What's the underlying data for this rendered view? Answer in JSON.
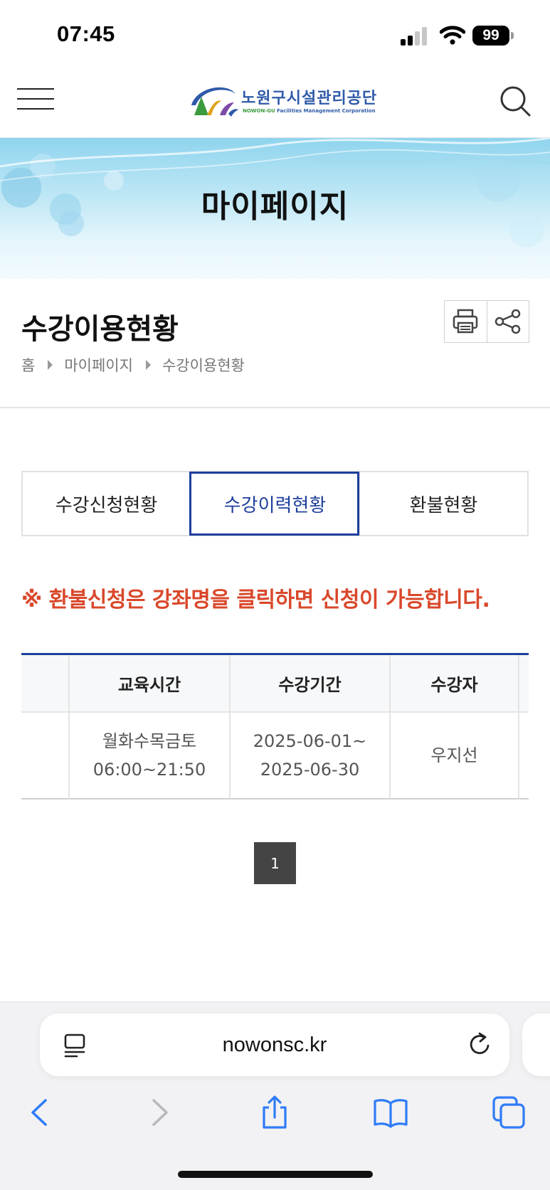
{
  "status_bar": {
    "time": "07:45",
    "battery": "99"
  },
  "header": {
    "logo_kr": "노원구시설관리공단",
    "logo_en_1": "NOWON-GU",
    "logo_en_2": "Facilities",
    "logo_en_3": "Management Corporation",
    "menu_icon": "hamburger-icon",
    "search_icon": "search-icon"
  },
  "banner": {
    "title": "마이페이지"
  },
  "page": {
    "title": "수강이용현황",
    "breadcrumb": [
      "홈",
      "마이페이지",
      "수강이용현황"
    ],
    "tools": [
      "print-icon",
      "share-icon"
    ]
  },
  "tabs": [
    {
      "label": "수강신청현황",
      "active": false
    },
    {
      "label": "수강이력현황",
      "active": true
    },
    {
      "label": "환불현황",
      "active": false
    }
  ],
  "notice": "※ 환불신청은 강좌명을 클릭하면 신청이 가능합니다.",
  "table": {
    "headers": [
      "",
      "교육시간",
      "수강기간",
      "수강자",
      ""
    ],
    "rows": [
      {
        "days": "월화수목금토",
        "hours": "06:00~21:50",
        "period_start": "2025-06-01~",
        "period_end": "2025-06-30",
        "student": "우지선"
      }
    ]
  },
  "pagination": {
    "current": "1"
  },
  "browser": {
    "url": "nowonsc.kr",
    "colors": {
      "accent": "#1f3f9c",
      "notice": "#d9482b",
      "ios_blue": "#2f7cf6"
    }
  }
}
